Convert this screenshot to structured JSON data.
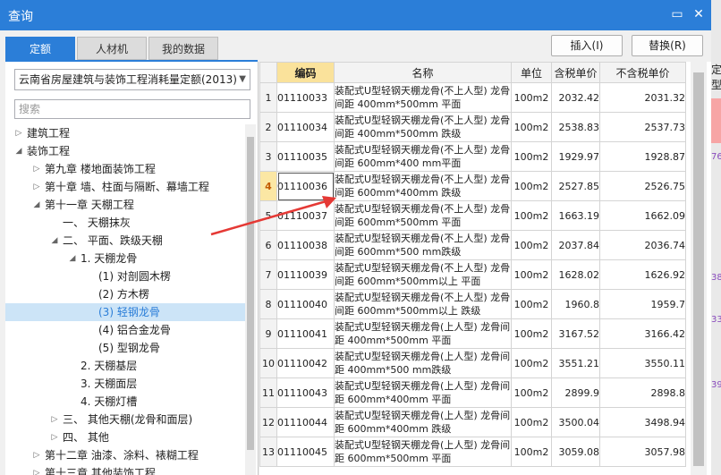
{
  "window": {
    "title": "查询",
    "min_icon": "▭",
    "close_icon": "✕"
  },
  "tabs": [
    {
      "label": "定额",
      "active": true
    },
    {
      "label": "人材机",
      "active": false
    },
    {
      "label": "我的数据",
      "active": false
    }
  ],
  "actions": {
    "insert_label": "插入(I)",
    "replace_label": "替换(R)"
  },
  "left": {
    "quota_select": "云南省房屋建筑与装饰工程消耗量定额(2013)",
    "search_placeholder": "搜索",
    "tree": [
      {
        "label": "建筑工程",
        "level": 0,
        "toggle": "▷"
      },
      {
        "label": "装饰工程",
        "level": 0,
        "toggle": "◢"
      },
      {
        "label": "第九章 楼地面装饰工程",
        "level": 1,
        "toggle": "▷"
      },
      {
        "label": "第十章 墙、柱面与隔断、幕墙工程",
        "level": 1,
        "toggle": "▷"
      },
      {
        "label": "第十一章 天棚工程",
        "level": 1,
        "toggle": "◢"
      },
      {
        "label": "一、 天棚抹灰",
        "level": 2,
        "toggle": ""
      },
      {
        "label": "二、 平面、跌级天棚",
        "level": 2,
        "toggle": "◢"
      },
      {
        "label": "1. 天棚龙骨",
        "level": 3,
        "toggle": "◢"
      },
      {
        "label": "(1) 对剖圆木楞",
        "level": 4,
        "toggle": ""
      },
      {
        "label": "(2) 方木楞",
        "level": 4,
        "toggle": ""
      },
      {
        "label": "(3) 轻钢龙骨",
        "level": 4,
        "toggle": "",
        "selected": true
      },
      {
        "label": "(4) 铝合金龙骨",
        "level": 4,
        "toggle": ""
      },
      {
        "label": "(5) 型钢龙骨",
        "level": 4,
        "toggle": ""
      },
      {
        "label": "2. 天棚基层",
        "level": 3,
        "toggle": ""
      },
      {
        "label": "3. 天棚面层",
        "level": 3,
        "toggle": ""
      },
      {
        "label": "4. 天棚灯槽",
        "level": 3,
        "toggle": ""
      },
      {
        "label": "三、 其他天棚(龙骨和面层)",
        "level": 2,
        "toggle": "▷"
      },
      {
        "label": "四、 其他",
        "level": 2,
        "toggle": "▷"
      },
      {
        "label": "第十二章 油漆、涂料、裱糊工程",
        "level": 1,
        "toggle": "▷"
      },
      {
        "label": "第十三章 其他装饰工程",
        "level": 1,
        "toggle": "▷"
      }
    ]
  },
  "table": {
    "columns": [
      "",
      "编码",
      "名称",
      "单位",
      "含税单价",
      "不含税单价"
    ],
    "current_row": 4,
    "rows": [
      {
        "num": "1",
        "code": "01110033",
        "name": "装配式U型轻钢天棚龙骨(不上人型) 龙骨间距 400mm*500mm 平面",
        "unit": "100m2",
        "price_tax": "2032.42",
        "price_notax": "2031.32"
      },
      {
        "num": "2",
        "code": "01110034",
        "name": "装配式U型轻钢天棚龙骨(不上人型) 龙骨间距 400mm*500mm 跌级",
        "unit": "100m2",
        "price_tax": "2538.83",
        "price_notax": "2537.73"
      },
      {
        "num": "3",
        "code": "01110035",
        "name": "装配式U型轻钢天棚龙骨(不上人型) 龙骨间距 600mm*400 mm平面",
        "unit": "100m2",
        "price_tax": "1929.97",
        "price_notax": "1928.87"
      },
      {
        "num": "4",
        "code": "01110036",
        "name": "装配式U型轻钢天棚龙骨(不上人型) 龙骨间距 600mm*400mm 跌级",
        "unit": "100m2",
        "price_tax": "2527.85",
        "price_notax": "2526.75"
      },
      {
        "num": "5",
        "code": "01110037",
        "name": "装配式U型轻钢天棚龙骨(不上人型) 龙骨间距 600mm*500mm 平面",
        "unit": "100m2",
        "price_tax": "1663.19",
        "price_notax": "1662.09"
      },
      {
        "num": "6",
        "code": "01110038",
        "name": "装配式U型轻钢天棚龙骨(不上人型) 龙骨间距 600mm*500 mm跌级",
        "unit": "100m2",
        "price_tax": "2037.84",
        "price_notax": "2036.74"
      },
      {
        "num": "7",
        "code": "01110039",
        "name": "装配式U型轻钢天棚龙骨(不上人型) 龙骨间距 600mm*500mm以上 平面",
        "unit": "100m2",
        "price_tax": "1628.02",
        "price_notax": "1626.92"
      },
      {
        "num": "8",
        "code": "01110040",
        "name": "装配式U型轻钢天棚龙骨(不上人型) 龙骨间距 600mm*500mm以上 跌级",
        "unit": "100m2",
        "price_tax": "1960.8",
        "price_notax": "1959.7"
      },
      {
        "num": "9",
        "code": "01110041",
        "name": "装配式U型轻钢天棚龙骨(上人型) 龙骨间距 400mm*500mm 平面",
        "unit": "100m2",
        "price_tax": "3167.52",
        "price_notax": "3166.42"
      },
      {
        "num": "10",
        "code": "01110042",
        "name": "装配式U型轻钢天棚龙骨(上人型) 龙骨间距 400mm*500 mm跌级",
        "unit": "100m2",
        "price_tax": "3551.21",
        "price_notax": "3550.11"
      },
      {
        "num": "11",
        "code": "01110043",
        "name": "装配式U型轻钢天棚龙骨(上人型) 龙骨间距 600mm*400mm 平面",
        "unit": "100m2",
        "price_tax": "2899.9",
        "price_notax": "2898.8"
      },
      {
        "num": "12",
        "code": "01110044",
        "name": "装配式U型轻钢天棚龙骨(上人型) 龙骨间距 600mm*400mm 跌级",
        "unit": "100m2",
        "price_tax": "3500.04",
        "price_notax": "3498.94"
      },
      {
        "num": "13",
        "code": "01110045",
        "name": "装配式U型轻钢天棚龙骨(上人型) 龙骨间距 600mm*500mm 平面",
        "unit": "100m2",
        "price_tax": "3059.08",
        "price_notax": "3057.98"
      }
    ]
  },
  "background_window": {
    "header": "定型",
    "numbers": [
      "76",
      "38",
      "33",
      "39"
    ]
  },
  "colors": {
    "accent": "#2b7ed8",
    "code_header": "#fae29b",
    "selected_tree": "#cce4f7",
    "annotation_arrow": "#e53935"
  }
}
